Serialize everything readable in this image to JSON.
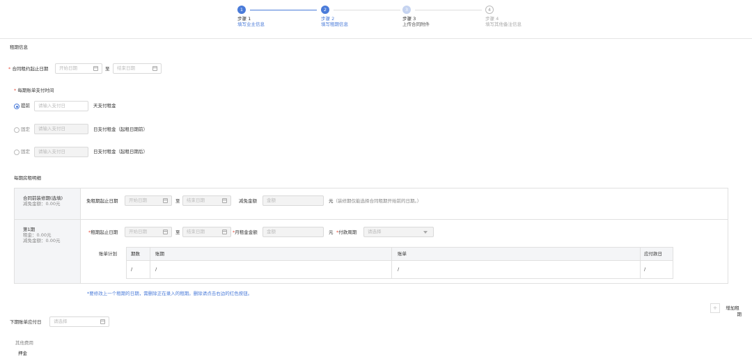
{
  "steps": [
    {
      "num": "1",
      "title": "步骤 1",
      "sub": "填写业主信息",
      "state": "done"
    },
    {
      "num": "2",
      "title": "步骤 2",
      "sub": "填写租期信息",
      "state": "active"
    },
    {
      "num": "3",
      "title": "步骤 3",
      "sub": "上传合同附件",
      "state": "pending"
    },
    {
      "num": "4",
      "title": "步骤 4",
      "sub": "填写其他备注信息",
      "state": "todo"
    }
  ],
  "lease": {
    "section_title": "租期信息",
    "contract_period_label": "合同租约起止日期",
    "start_placeholder": "开始日期",
    "end_placeholder": "结束日期",
    "to": "至"
  },
  "payment": {
    "label": "每期账单支付时间",
    "opt1_label": "提前",
    "opt1_placeholder": "请输入支付日",
    "opt1_suffix": "天支付租金",
    "opt2_label": "固定",
    "opt2_placeholder": "请输入支付日",
    "opt2_suffix": "日支付租金（起租日期前）",
    "opt3_label": "固定",
    "opt3_placeholder": "请输入支付日",
    "opt3_suffix": "日支付租金（起租日期后）"
  },
  "detail": {
    "title": "每期房租明细",
    "pre": {
      "name": "合同前装修期(选填)",
      "reduction": "减免金额：0.00元",
      "free_label": "免租期起止日期",
      "start_placeholder": "开始日期",
      "end_placeholder": "结束日期",
      "to": "至",
      "amount_label": "减免金额",
      "amount_placeholder": "金额",
      "unit": "元",
      "note": "（装修期仅能选择合同租期开始前的日期。）"
    },
    "period1": {
      "name": "第1期",
      "rent": "租金：0.00元",
      "reduction": "减免金额：0.00元",
      "range_label": "租期起止日期",
      "start_placeholder": "开始日期",
      "end_placeholder": "结束日期",
      "to": "至",
      "rent_label": "月租金金额",
      "rent_placeholder": "金额",
      "unit": "元",
      "cycle_label": "付款周期",
      "cycle_placeholder": "请选择",
      "plan_label": "账单计划",
      "columns": [
        "期数",
        "账期",
        "账单",
        "应付款日"
      ],
      "row": [
        "/",
        "/",
        "/",
        "/"
      ]
    }
  },
  "hint": "*要修改上一个租期的日期，需删除正在录入的租期。删除请点击右边的红色按钮。",
  "add_period": {
    "icon": "+",
    "label_line1": "增加租",
    "label_line2": "期"
  },
  "next_due": {
    "label": "下期账单应付日",
    "placeholder": "请选择"
  },
  "other": {
    "title": "其他费用",
    "deposit": "押金"
  }
}
